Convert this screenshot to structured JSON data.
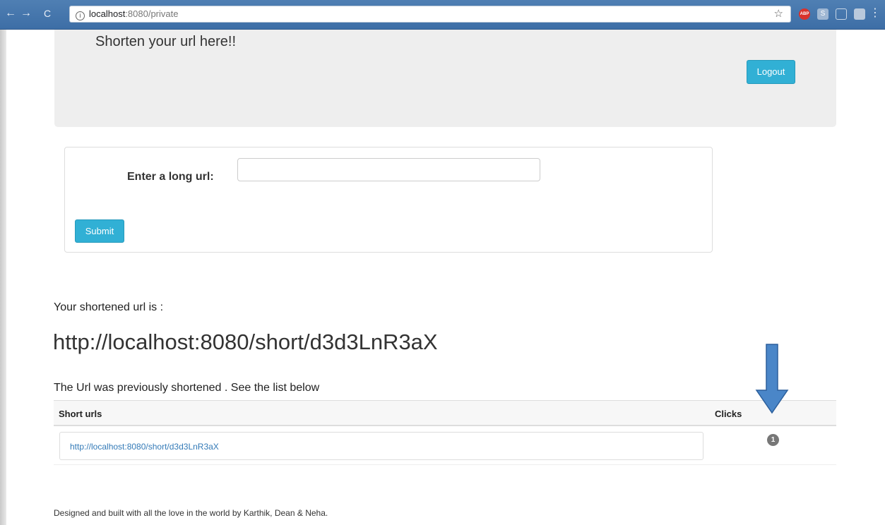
{
  "browser": {
    "url_host": "localhost",
    "url_rest": ":8080/private",
    "back_glyph": "←",
    "forward_glyph": "→",
    "reload_glyph": "C",
    "star_glyph": "☆",
    "ext_abp_label": "ABP",
    "ext_s_label": "S",
    "menu_glyph": "⋮"
  },
  "header": {
    "title": "Shorten your url here!!",
    "logout_label": "Logout"
  },
  "form": {
    "label": "Enter a long url:",
    "input_value": "",
    "submit_label": "Submit"
  },
  "result": {
    "label": "Your shortened url is :",
    "url": "http://localhost:8080/short/d3d3LnR3aX",
    "previous_note": "The Url was previously shortened . See the list below"
  },
  "table": {
    "headers": [
      "Short urls",
      "Clicks"
    ],
    "rows": [
      {
        "short_url": "http://localhost:8080/short/d3d3LnR3aX",
        "clicks": "1"
      }
    ]
  },
  "footer": {
    "text": "Designed and built with all the love in the world by Karthik, Dean & Neha."
  },
  "colors": {
    "accent": "#31b0d5",
    "link": "#337ab7",
    "arrow": "#4a86c8"
  }
}
